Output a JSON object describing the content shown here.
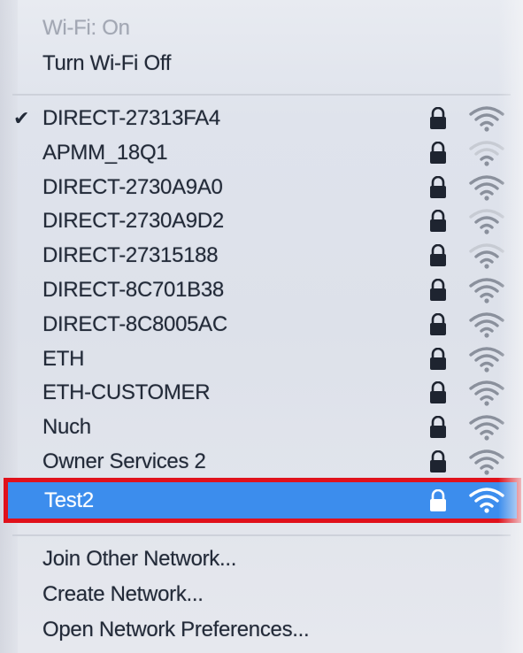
{
  "wifi_menu": {
    "status_label": "Wi-Fi: On",
    "toggle_label": "Turn Wi-Fi Off",
    "networks": [
      {
        "name": "DIRECT-27313FA4",
        "connected": true,
        "locked": true,
        "signal": 3
      },
      {
        "name": "APMM_18Q1",
        "connected": false,
        "locked": true,
        "signal": 1
      },
      {
        "name": "DIRECT-2730A9A0",
        "connected": false,
        "locked": true,
        "signal": 3
      },
      {
        "name": "DIRECT-2730A9D2",
        "connected": false,
        "locked": true,
        "signal": 2
      },
      {
        "name": "DIRECT-27315188",
        "connected": false,
        "locked": true,
        "signal": 2
      },
      {
        "name": "DIRECT-8C701B38",
        "connected": false,
        "locked": true,
        "signal": 3
      },
      {
        "name": "DIRECT-8C8005AC",
        "connected": false,
        "locked": true,
        "signal": 3
      },
      {
        "name": "ETH",
        "connected": false,
        "locked": true,
        "signal": 3
      },
      {
        "name": "ETH-CUSTOMER",
        "connected": false,
        "locked": true,
        "signal": 3
      },
      {
        "name": "Nuch",
        "connected": false,
        "locked": true,
        "signal": 3
      },
      {
        "name": "Owner Services 2",
        "connected": false,
        "locked": true,
        "signal": 3
      }
    ],
    "selected_network": {
      "name": "Test2",
      "locked": true,
      "signal": 3
    },
    "actions": {
      "join_other": "Join Other Network...",
      "create_network": "Create Network...",
      "open_preferences": "Open Network Preferences..."
    },
    "colors": {
      "highlight": "#3c8ded",
      "highlight_border": "#e0111b",
      "text": "#222a38",
      "disabled_text": "#a2a7b3"
    }
  }
}
